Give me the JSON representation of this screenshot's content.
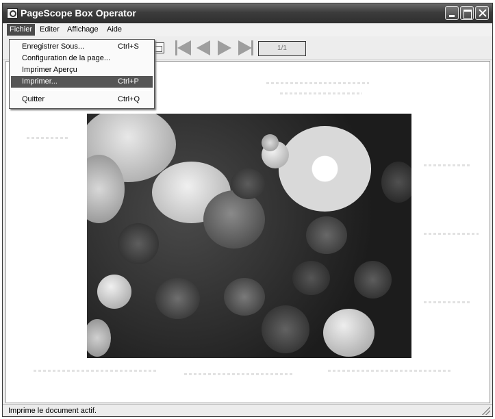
{
  "window": {
    "title": "PageScope Box Operator"
  },
  "menubar": {
    "items": [
      {
        "label": "Fichier"
      },
      {
        "label": "Editer"
      },
      {
        "label": "Affichage"
      },
      {
        "label": "Aide"
      }
    ]
  },
  "file_menu": {
    "items": [
      {
        "label": "Enregistrer Sous...",
        "shortcut": "Ctrl+S"
      },
      {
        "label": "Configuration de la page...",
        "shortcut": ""
      },
      {
        "label": "Imprimer Aperçu",
        "shortcut": ""
      },
      {
        "label": "Imprimer...",
        "shortcut": "Ctrl+P"
      },
      {
        "label": "Quitter",
        "shortcut": "Ctrl+Q"
      }
    ],
    "selected_item": "Imprimer..."
  },
  "toolbar": {
    "page_indicator": "1/1"
  },
  "statusbar": {
    "text": "Imprime le document actif."
  },
  "colors": {
    "title_bar": "#3c3c3c",
    "menu_highlight": "#555555"
  },
  "icons": [
    "app-icon",
    "minimize-icon",
    "maximize-icon",
    "close-icon",
    "page-setup-icon",
    "first-page-icon",
    "previous-page-icon",
    "next-page-icon",
    "last-page-icon"
  ]
}
